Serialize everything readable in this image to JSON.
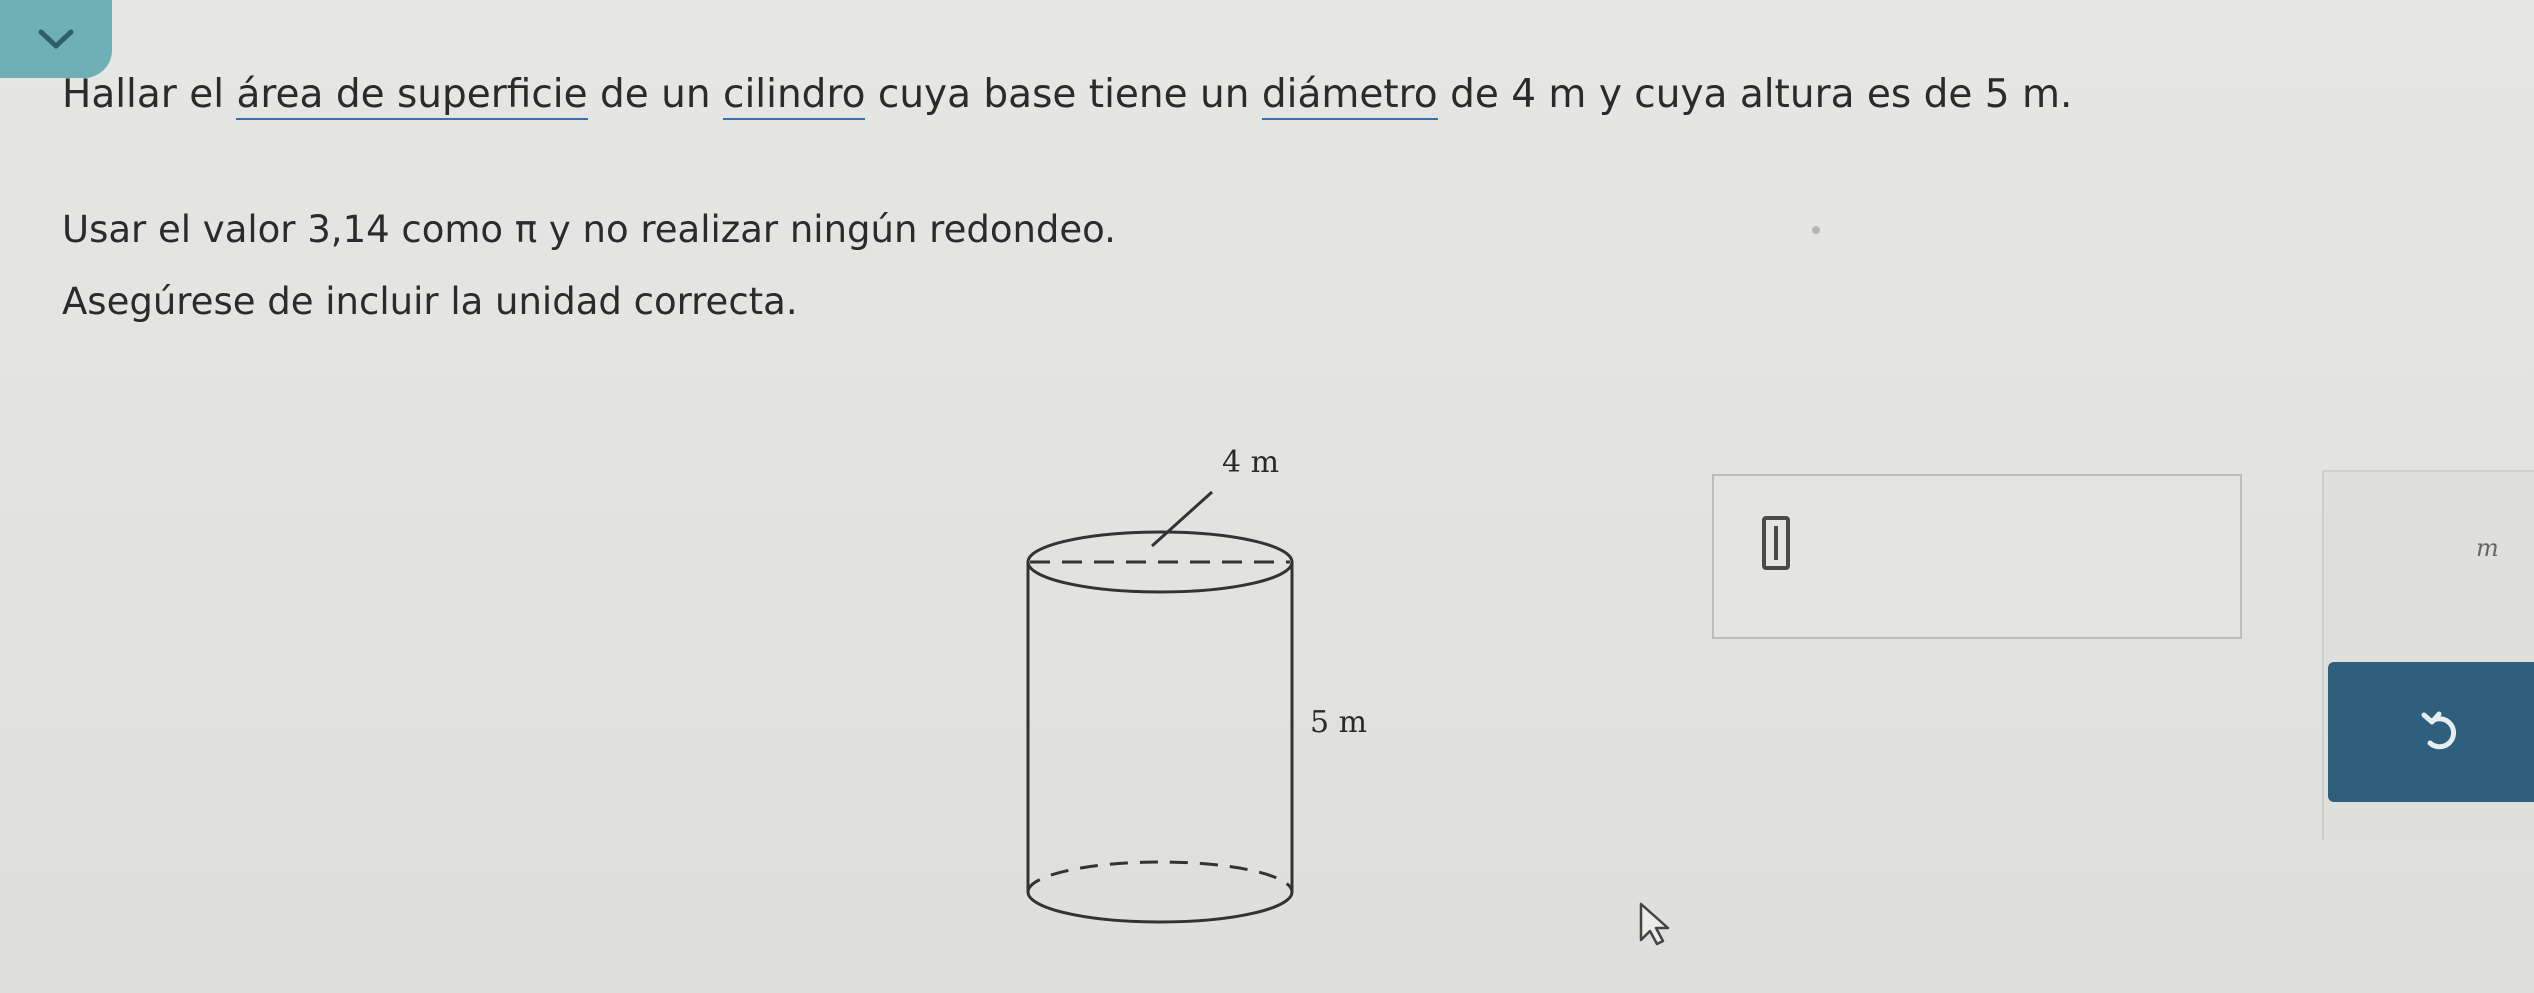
{
  "question": {
    "line1_prefix": "Hallar el ",
    "line1_term1": "área de superficie",
    "line1_mid1": " de un ",
    "line1_term2": "cilindro",
    "line1_mid2": " cuya base tiene un ",
    "line1_term3": "diámetro",
    "line1_suffix": " de 4 m y cuya altura es de 5 m.",
    "line2": "Usar el valor 3,14 como π y no realizar ningún redondeo.",
    "line3": "Asegúrese de incluir la unidad correcta."
  },
  "figure": {
    "diameter_label": "4 m",
    "height_label": "5 m"
  },
  "answer": {
    "value": ""
  },
  "keypad": {
    "unit_key": "m"
  },
  "icons": {
    "collapse": "chevron-down-icon",
    "undo": "undo-icon",
    "cursor": "mouse-pointer-icon"
  }
}
